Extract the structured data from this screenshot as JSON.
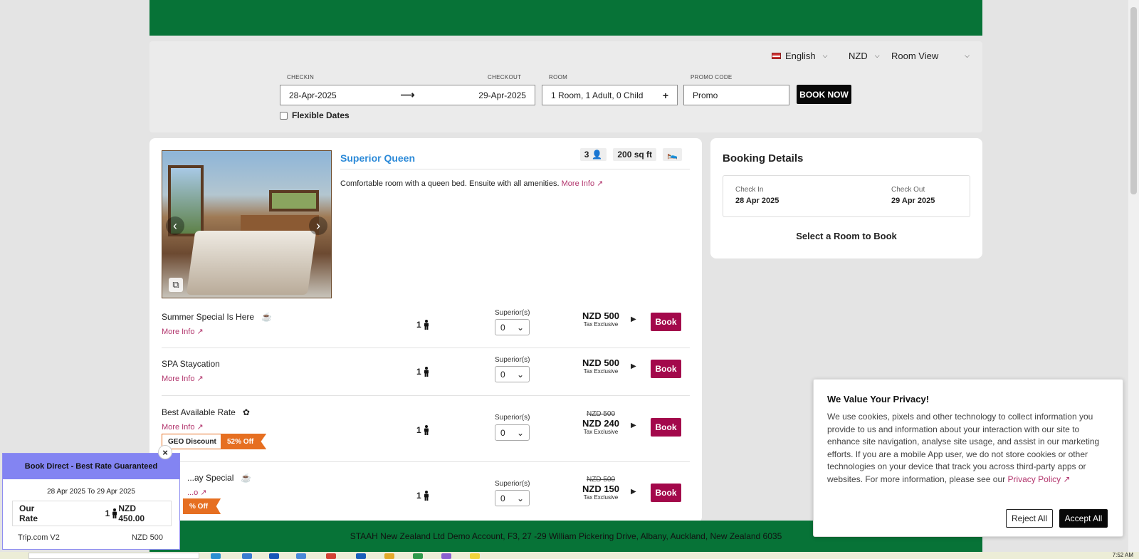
{
  "header": {},
  "search": {
    "language": "English",
    "currency": "NZD",
    "view": "Room View",
    "checkin_label": "CHECKIN",
    "checkout_label": "CHECKOUT",
    "room_label": "ROOM",
    "promo_label": "PROMO CODE",
    "checkin_value": "28-Apr-2025",
    "checkout_value": "29-Apr-2025",
    "room_value": "1 Room, 1 Adult, 0 Child",
    "promo_value": "Promo",
    "book_now": "BOOK NOW",
    "flexible_dates": "Flexible Dates"
  },
  "room": {
    "title": "Superior Queen",
    "occupancy": "3",
    "size": "200 sq ft",
    "description": "Comfortable room with a queen bed. Ensuite with all amenities.",
    "more_info": "More Info"
  },
  "rates": [
    {
      "name": "Summer Special Is Here",
      "more_info": "More Info",
      "occupancy": "1",
      "unit_label": "Superior(s)",
      "qty": "0",
      "old_price": "",
      "price": "NZD 500",
      "tax": "Tax Exclusive",
      "book": "Book"
    },
    {
      "name": "SPA Staycation",
      "more_info": "More Info",
      "occupancy": "1",
      "unit_label": "Superior(s)",
      "qty": "0",
      "old_price": "",
      "price": "NZD 500",
      "tax": "Tax Exclusive",
      "book": "Book"
    },
    {
      "name": "Best Available Rate",
      "more_info": "More Info",
      "occupancy": "1",
      "unit_label": "Superior(s)",
      "qty": "0",
      "old_price": "NZD 500",
      "price": "NZD 240",
      "tax": "Tax Exclusive",
      "book": "Book",
      "badge_geo": "GEO Discount",
      "badge_off": "52% Off"
    },
    {
      "name": "...ay Special",
      "more_info": "...o",
      "occupancy": "1",
      "unit_label": "Superior(s)",
      "qty": "0",
      "old_price": "NZD 500",
      "price": "NZD 150",
      "tax": "Tax Exclusive",
      "book": "Book",
      "badge_off": "% Off"
    }
  ],
  "booking": {
    "title": "Booking Details",
    "check_in_label": "Check In",
    "check_in_value": "28 Apr 2025",
    "check_out_label": "Check Out",
    "check_out_value": "29 Apr 2025",
    "select_msg": "Select a Room to Book"
  },
  "footer": {
    "address": "STAAH New Zealand Ltd Demo Account, F3, 27 -29 William Pickering Drive, Albany, Auckland, New Zealand 6035"
  },
  "privacy": {
    "title": "We Value Your Privacy!",
    "body": "We use cookies, pixels and other technology to collect information you provide to us and information about your interaction with our site to enhance site navigation, analyse site usage, and assist in our marketing efforts. If you are a mobile App user, we do not store cookies or other technologies on your device that track you across third-party apps or websites. For more information, please see our",
    "link": "Privacy Policy",
    "reject": "Reject All",
    "accept": "Accept All"
  },
  "best_rate": {
    "title": "Book Direct - Best Rate Guaranteed",
    "dates": "28 Apr 2025 To 29 Apr 2025",
    "our_rate_label": "Our Rate",
    "occupancy": "1",
    "our_rate_value": "NZD 450.00",
    "other_label": "Trip.com V2",
    "other_value": "NZD 500"
  },
  "taskbar": {
    "clock": "7:52 AM"
  },
  "colors": {
    "brand_green": "#077337",
    "book_button": "#a3084b",
    "link": "#b2346c",
    "title_blue": "#2c8ad8",
    "offer_orange": "#e66f21",
    "best_rate_purple": "#8384f2"
  },
  "icons": [
    "person-icon",
    "coffee-icon",
    "bed-icon",
    "external-link-icon",
    "chevron-down-icon",
    "arrow-right-icon",
    "gallery-icon",
    "close-icon"
  ]
}
